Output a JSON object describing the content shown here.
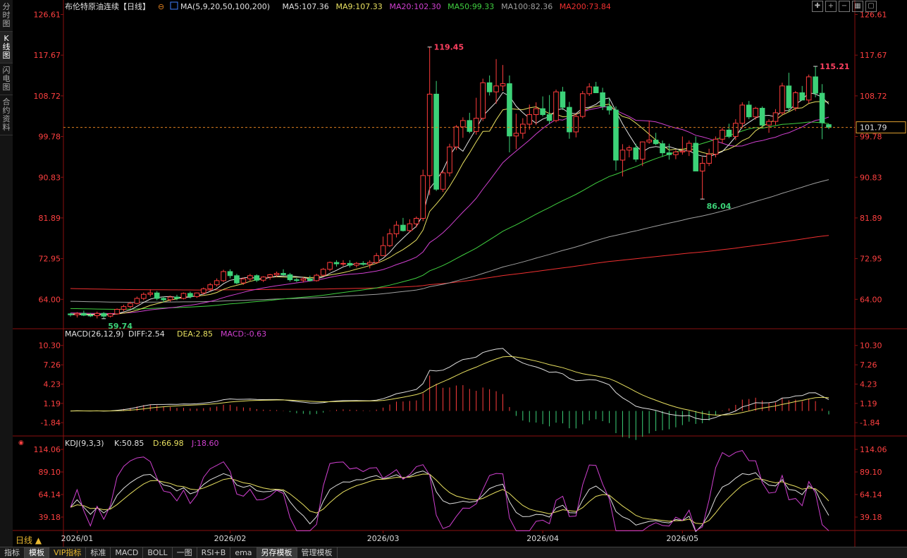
{
  "side_tabs": [
    "分时图",
    "K线图",
    "闪电图",
    "合约资料"
  ],
  "header": {
    "title": "布伦特原油连续",
    "period_tag": "【日线】",
    "ma_def": "MA(5,9,20,50,100,200)",
    "ma_values": [
      {
        "text": "MA5:107.36",
        "color": "#e0e0e0"
      },
      {
        "text": "MA9:107.33",
        "color": "#e8e060"
      },
      {
        "text": "MA20:102.30",
        "color": "#d040d0"
      },
      {
        "text": "MA50:99.33",
        "color": "#40d040"
      },
      {
        "text": "MA100:82.36",
        "color": "#a0a0a0"
      },
      {
        "text": "MA200:73.84",
        "color": "#f03030"
      }
    ]
  },
  "bottom_tabs": [
    "指标",
    "模板",
    "VIP指标",
    "标准",
    "MACD",
    "BOLL",
    "一图",
    "RSI+B",
    "ema",
    "另存模板",
    "管理模板"
  ],
  "period_label": "日线 ▲",
  "colors": {
    "up": "#ff3c3c",
    "down": "#3cd278",
    "axis": "#ff4040",
    "ma5": "#e0e0e0",
    "ma9": "#e8e060",
    "ma20": "#d040d0",
    "ma50": "#40d040",
    "ma100": "#a0a0a0",
    "ma200": "#f03030"
  },
  "chart_data": [
    {
      "type": "candlestick",
      "title": "布伦特原油连续【日线】",
      "yticks": [
        "126.61",
        "117.67",
        "108.72",
        "99.78",
        "90.83",
        "81.89",
        "72.95",
        "64.00"
      ],
      "ylim": [
        58.0,
        127.0
      ],
      "xticks": [
        "2026/01",
        "2026/02",
        "2026/03",
        "2026/04",
        "2026/05"
      ],
      "current_price": "101.79",
      "annotations": [
        {
          "text": "119.45",
          "type": "high"
        },
        {
          "text": "115.21",
          "type": "high"
        },
        {
          "text": "86.04",
          "type": "low"
        },
        {
          "text": "59.74",
          "type": "low"
        }
      ],
      "ohlc": [
        [
          60.8,
          61.0,
          60.2,
          60.6
        ],
        [
          60.6,
          61.2,
          60.0,
          60.9
        ],
        [
          60.9,
          61.5,
          60.3,
          60.5
        ],
        [
          60.5,
          61.0,
          60.1,
          60.4
        ],
        [
          60.4,
          61.3,
          59.8,
          60.9
        ],
        [
          60.9,
          61.2,
          59.74,
          60.3
        ],
        [
          60.3,
          61.0,
          60.0,
          60.8
        ],
        [
          60.8,
          62.0,
          60.6,
          61.8
        ],
        [
          61.8,
          62.8,
          61.4,
          62.4
        ],
        [
          62.4,
          63.5,
          62.0,
          63.1
        ],
        [
          63.1,
          64.6,
          62.9,
          64.2
        ],
        [
          64.2,
          65.5,
          63.8,
          65.1
        ],
        [
          65.1,
          66.2,
          64.6,
          65.4
        ],
        [
          65.4,
          65.8,
          63.8,
          64.2
        ],
        [
          64.2,
          64.6,
          63.3,
          63.9
        ],
        [
          63.9,
          64.8,
          63.5,
          64.5
        ],
        [
          64.5,
          65.0,
          63.8,
          64.2
        ],
        [
          64.2,
          65.5,
          64.0,
          65.3
        ],
        [
          65.3,
          65.7,
          64.2,
          64.6
        ],
        [
          64.6,
          65.5,
          64.3,
          65.4
        ],
        [
          65.4,
          66.6,
          65.0,
          66.3
        ],
        [
          66.3,
          67.6,
          65.8,
          67.2
        ],
        [
          67.2,
          68.6,
          66.8,
          68.1
        ],
        [
          68.1,
          70.5,
          67.8,
          70.1
        ],
        [
          70.1,
          70.6,
          68.6,
          69.2
        ],
        [
          69.2,
          69.6,
          67.3,
          67.6
        ],
        [
          67.6,
          68.8,
          67.2,
          68.5
        ],
        [
          68.5,
          69.6,
          68.0,
          69.2
        ],
        [
          69.2,
          69.5,
          67.8,
          68.2
        ],
        [
          68.2,
          69.1,
          67.8,
          68.9
        ],
        [
          68.9,
          69.6,
          68.3,
          69.4
        ],
        [
          69.4,
          70.1,
          68.9,
          69.7
        ],
        [
          69.7,
          70.6,
          69.2,
          69.4
        ],
        [
          69.4,
          69.8,
          67.9,
          68.3
        ],
        [
          68.3,
          68.7,
          67.8,
          68.2
        ],
        [
          68.2,
          68.9,
          67.7,
          68.5
        ],
        [
          68.5,
          69.2,
          67.9,
          68.1
        ],
        [
          68.1,
          69.6,
          67.9,
          69.3
        ],
        [
          69.3,
          70.9,
          69.0,
          70.6
        ],
        [
          70.6,
          72.3,
          70.2,
          72.1
        ],
        [
          72.1,
          72.6,
          71.2,
          71.8
        ],
        [
          71.8,
          72.6,
          71.3,
          71.9
        ],
        [
          71.9,
          72.6,
          71.0,
          71.5
        ],
        [
          71.5,
          72.2,
          71.0,
          71.9
        ],
        [
          71.9,
          72.4,
          71.4,
          71.7
        ],
        [
          71.7,
          72.6,
          70.8,
          72.1
        ],
        [
          72.1,
          74.2,
          71.8,
          73.6
        ],
        [
          73.6,
          77.8,
          75.6,
          75.8
        ],
        [
          75.8,
          79.5,
          75.5,
          78.4
        ],
        [
          78.4,
          81.2,
          77.6,
          80.3
        ],
        [
          80.3,
          81.9,
          78.9,
          79.1
        ],
        [
          79.1,
          81.6,
          78.7,
          80.6
        ],
        [
          80.6,
          82.2,
          79.8,
          81.8
        ],
        [
          81.8,
          92.5,
          81.2,
          91.2
        ],
        [
          91.2,
          119.45,
          86.9,
          109.1
        ],
        [
          109.1,
          112.0,
          87.8,
          88.2
        ],
        [
          88.2,
          92.3,
          87.6,
          91.8
        ],
        [
          91.8,
          98.2,
          91.0,
          97.5
        ],
        [
          97.5,
          102.3,
          96.8,
          101.9
        ],
        [
          101.9,
          104.0,
          99.5,
          103.3
        ],
        [
          103.3,
          105.0,
          100.5,
          100.9
        ],
        [
          100.9,
          108.3,
          100.2,
          103.8
        ],
        [
          103.8,
          112.5,
          103.2,
          111.6
        ],
        [
          111.6,
          113.2,
          108.8,
          109.6
        ],
        [
          109.6,
          116.8,
          107.0,
          110.9
        ],
        [
          110.9,
          115.5,
          109.8,
          111.4
        ],
        [
          111.4,
          113.2,
          96.3,
          99.9
        ],
        [
          99.9,
          104.8,
          97.0,
          100.5
        ],
        [
          100.5,
          103.8,
          99.3,
          102.5
        ],
        [
          102.5,
          106.8,
          101.3,
          104.6
        ],
        [
          104.6,
          107.3,
          102.3,
          105.9
        ],
        [
          105.9,
          108.6,
          104.2,
          104.6
        ],
        [
          104.6,
          108.9,
          102.5,
          103.3
        ],
        [
          103.3,
          110.1,
          102.9,
          109.6
        ],
        [
          109.6,
          110.7,
          105.6,
          106.2
        ],
        [
          106.2,
          107.4,
          99.3,
          100.8
        ],
        [
          100.8,
          104.8,
          99.6,
          104.2
        ],
        [
          104.2,
          109.8,
          103.8,
          109.2
        ],
        [
          109.2,
          111.5,
          108.7,
          110.7
        ],
        [
          110.7,
          111.8,
          110.3,
          109.4
        ],
        [
          109.4,
          110.5,
          105.6,
          106.4
        ],
        [
          106.4,
          108.2,
          104.6,
          105.6
        ],
        [
          105.6,
          106.4,
          92.3,
          94.6
        ],
        [
          94.6,
          98.1,
          91.0,
          96.8
        ],
        [
          96.8,
          97.8,
          95.2,
          97.3
        ],
        [
          97.3,
          98.2,
          94.2,
          94.8
        ],
        [
          94.8,
          98.7,
          93.3,
          98.6
        ],
        [
          98.6,
          103.3,
          98.2,
          99.0
        ],
        [
          99.0,
          100.6,
          97.9,
          98.2
        ],
        [
          98.2,
          98.9,
          95.3,
          96.2
        ],
        [
          96.2,
          98.2,
          94.7,
          95.8
        ],
        [
          95.8,
          96.8,
          94.8,
          96.4
        ],
        [
          96.4,
          99.8,
          95.8,
          96.6
        ],
        [
          96.6,
          98.9,
          95.5,
          98.3
        ],
        [
          98.3,
          99.8,
          93.8,
          92.2
        ],
        [
          92.2,
          95.3,
          86.04,
          93.9
        ],
        [
          93.9,
          97.1,
          93.3,
          95.9
        ],
        [
          95.9,
          99.8,
          95.2,
          99.2
        ],
        [
          99.2,
          101.8,
          98.3,
          101.2
        ],
        [
          101.2,
          102.6,
          99.4,
          99.8
        ],
        [
          99.8,
          103.6,
          99.0,
          102.7
        ],
        [
          102.7,
          107.3,
          101.6,
          106.7
        ],
        [
          106.7,
          107.6,
          103.6,
          104.1
        ],
        [
          104.1,
          106.3,
          103.5,
          106.0
        ],
        [
          106.0,
          106.4,
          101.9,
          102.3
        ],
        [
          102.3,
          103.6,
          100.6,
          103.1
        ],
        [
          103.1,
          105.8,
          102.3,
          105.0
        ],
        [
          105.0,
          111.6,
          104.5,
          110.9
        ],
        [
          110.9,
          113.8,
          105.2,
          106.1
        ],
        [
          106.1,
          109.8,
          105.4,
          109.4
        ],
        [
          109.4,
          110.9,
          108.1,
          107.8
        ],
        [
          107.8,
          113.4,
          107.1,
          112.9
        ],
        [
          112.9,
          115.21,
          108.4,
          109.3
        ],
        [
          109.3,
          111.3,
          99.2,
          102.8
        ],
        [
          102.4,
          102.6,
          101.4,
          101.8
        ]
      ]
    },
    {
      "type": "macd",
      "title": "MACD(26,12,9)",
      "values": [
        {
          "text": "DIFF:2.54",
          "color": "#e0e0e0"
        },
        {
          "text": "DEA:2.85",
          "color": "#e8e060"
        },
        {
          "text": "MACD:-0.63",
          "color": "#d040d0"
        }
      ],
      "yticks": [
        "10.30",
        "7.26",
        "4.23",
        "1.19",
        "-1.84"
      ],
      "ylim": [
        -3.6,
        11.6
      ]
    },
    {
      "type": "kdj",
      "title": "KDJ(9,3,3)",
      "values": [
        {
          "text": "K:50.85",
          "color": "#e0e0e0"
        },
        {
          "text": "D:66.98",
          "color": "#e8e060"
        },
        {
          "text": "J:18.60",
          "color": "#d040d0"
        }
      ],
      "yticks": [
        "114.06",
        "89.10",
        "64.14",
        "39.18"
      ],
      "ylim": [
        22,
        118
      ]
    }
  ]
}
